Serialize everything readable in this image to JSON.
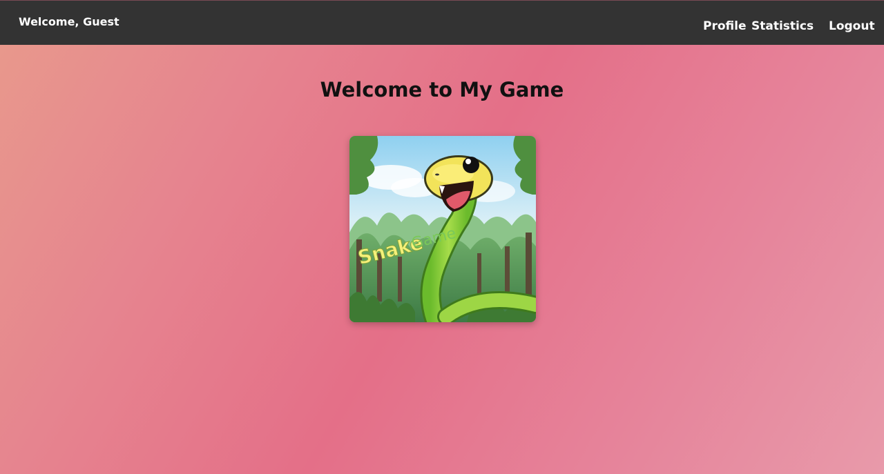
{
  "header": {
    "welcome_text": "Welcome, Guest",
    "nav": {
      "profile": "Profile",
      "statistics": "Statistics",
      "logout": "Logout"
    }
  },
  "main": {
    "title": "Welcome to My Game",
    "game_card": {
      "name": "snake-game",
      "logo_text_primary": "Snake",
      "logo_text_secondary": "Game"
    }
  },
  "colors": {
    "navbar": "#333333",
    "background_start": "#e89a8c",
    "background_mid": "#e46f88",
    "background_end": "#e89aaa"
  }
}
